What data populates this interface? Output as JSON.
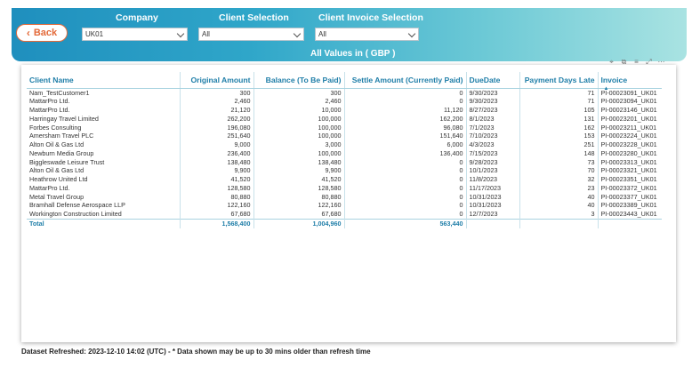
{
  "header": {
    "back_label": "Back",
    "company_label": "Company",
    "company_value": "UK01",
    "client_selection_label": "Client Selection",
    "client_selection_value": "All",
    "client_invoice_label": "Client Invoice Selection",
    "client_invoice_value": "All",
    "values_note": "All Values in ( GBP )"
  },
  "toolbar_icons": [
    "pin-icon",
    "copy-icon",
    "filter-icon",
    "focus-mode-icon",
    "more-options-icon"
  ],
  "table": {
    "columns": [
      "Client Name",
      "Original Amount",
      "Balance (To Be Paid)",
      "Settle Amount (Currently Paid)",
      "DueDate",
      "Payment Days Late",
      "Invoice"
    ],
    "rows": [
      [
        "Nam_TestCustomer1",
        "300",
        "300",
        "0",
        "9/30/2023",
        "71",
        "PI-00023091_UK01"
      ],
      [
        "MattarPro Ltd.",
        "2,460",
        "2,460",
        "0",
        "9/30/2023",
        "71",
        "PI-00023094_UK01"
      ],
      [
        "MattarPro Ltd.",
        "21,120",
        "10,000",
        "11,120",
        "8/27/2023",
        "105",
        "PI-00023146_UK01"
      ],
      [
        "Harringay Travel Limited",
        "262,200",
        "100,000",
        "162,200",
        "8/1/2023",
        "131",
        "PI-00023201_UK01"
      ],
      [
        "Forbes Consulting",
        "196,080",
        "100,000",
        "96,080",
        "7/1/2023",
        "162",
        "PI-00023211_UK01"
      ],
      [
        "Amersham Travel PLC",
        "251,640",
        "100,000",
        "151,640",
        "7/10/2023",
        "153",
        "PI-00023224_UK01"
      ],
      [
        "Alton Oil & Gas Ltd",
        "9,000",
        "3,000",
        "6,000",
        "4/3/2023",
        "251",
        "PI-00023228_UK01"
      ],
      [
        "Newburn Media Group",
        "236,400",
        "100,000",
        "136,400",
        "7/15/2023",
        "148",
        "PI-00023280_UK01"
      ],
      [
        "Biggleswade Leisure Trust",
        "138,480",
        "138,480",
        "0",
        "9/28/2023",
        "73",
        "PI-00023313_UK01"
      ],
      [
        "Alton Oil & Gas Ltd",
        "9,900",
        "9,900",
        "0",
        "10/1/2023",
        "70",
        "PI-00023321_UK01"
      ],
      [
        "Heathrow United Ltd",
        "41,520",
        "41,520",
        "0",
        "11/8/2023",
        "32",
        "PI-00023351_UK01"
      ],
      [
        "MattarPro Ltd.",
        "128,580",
        "128,580",
        "0",
        "11/17/2023",
        "23",
        "PI-00023372_UK01"
      ],
      [
        "Metal Travel Group",
        "80,880",
        "80,880",
        "0",
        "10/31/2023",
        "40",
        "PI-00023377_UK01"
      ],
      [
        "Bramhall Defense Aerospace LLP",
        "122,160",
        "122,160",
        "0",
        "10/31/2023",
        "40",
        "PI-00023389_UK01"
      ],
      [
        "Workington Construction Limited",
        "67,680",
        "67,680",
        "0",
        "12/7/2023",
        "3",
        "PI-00023443_UK01"
      ]
    ],
    "total": [
      "Total",
      "1,568,400",
      "1,004,960",
      "563,440",
      "",
      "",
      ""
    ]
  },
  "footer": {
    "refresh_text": "Dataset Refreshed: 2023-12-10 14:02 (UTC) - * Data shown may be up to 30 mins older than refresh time"
  }
}
